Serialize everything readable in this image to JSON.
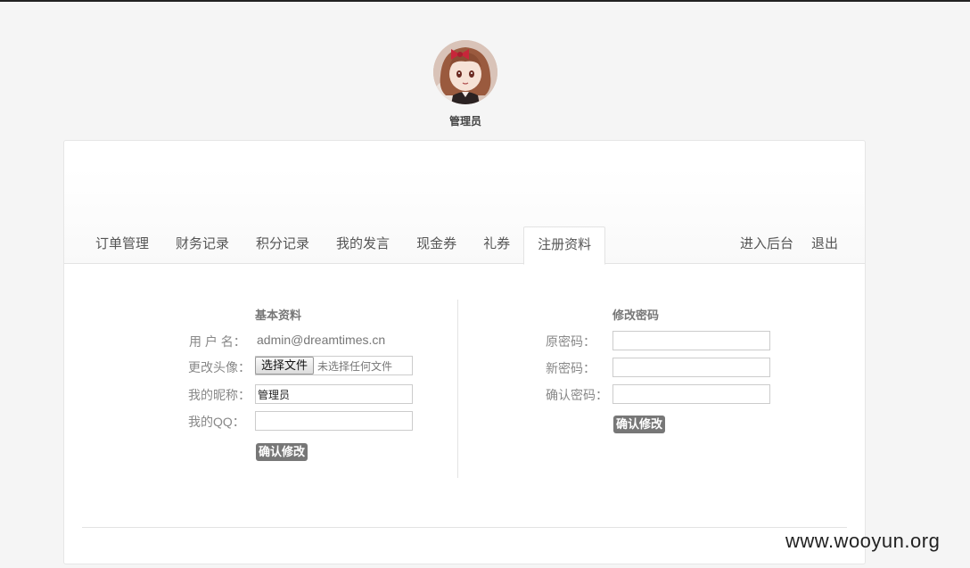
{
  "profile": {
    "display_name": "管理员"
  },
  "tabs": [
    {
      "label": "订单管理"
    },
    {
      "label": "财务记录"
    },
    {
      "label": "积分记录"
    },
    {
      "label": "我的发言"
    },
    {
      "label": "现金券"
    },
    {
      "label": "礼券"
    },
    {
      "label": "注册资料",
      "active": true
    }
  ],
  "header_links": {
    "admin": "进入后台",
    "logout": "退出"
  },
  "basic_info": {
    "title": "基本资料",
    "username_label": "用 户 名：",
    "username_value": "admin@dreamtimes.cn",
    "avatar_label": "更改头像：",
    "file_button": "选择文件",
    "file_status": "未选择任何文件",
    "nickname_label": "我的昵称：",
    "nickname_value": "管理员",
    "qq_label": "我的QQ：",
    "qq_value": "",
    "submit": "确认修改"
  },
  "password": {
    "title": "修改密码",
    "old_label": "原密码：",
    "new_label": "新密码：",
    "confirm_label": "确认密码：",
    "submit": "确认修改"
  },
  "watermark": "www.wooyun.org"
}
